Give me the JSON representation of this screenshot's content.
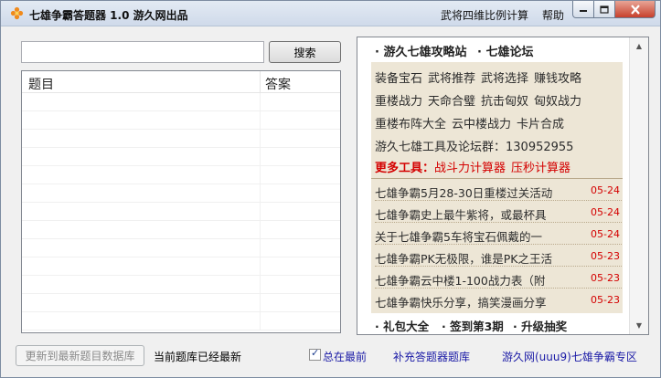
{
  "window": {
    "title": "七雄争霸答题器 1.0   游久网出品",
    "menu": [
      "武将四维比例计算",
      "帮助"
    ],
    "colors": {
      "accent_red": "#d40000",
      "link_blue": "#1a1aa6",
      "panel_bg": "#ede6d6"
    }
  },
  "icons": {
    "app": "orange-flower-icon",
    "minimize": "minimize-icon",
    "maximize": "maximize-icon",
    "close": "close-icon"
  },
  "search": {
    "value": "",
    "placeholder": "",
    "button_label": "搜索"
  },
  "list": {
    "columns": [
      "题目",
      "答案"
    ],
    "rows": []
  },
  "panel": {
    "top_links": [
      "· 游久七雄攻略站",
      "· 七雄论坛"
    ],
    "link_lines": [
      [
        "装备宝石",
        "武将推荐",
        "武将选择",
        "赚钱攻略"
      ],
      [
        "重楼战力",
        "天命合璧",
        "抗击匈奴",
        "匈奴战力"
      ],
      [
        "重楼布阵大全",
        "云中楼战力",
        "卡片合成"
      ]
    ],
    "forum_group": "游久七雄工具及论坛群：130952955",
    "more_tools": {
      "label": "更多工具：",
      "items": [
        "战斗力计算器",
        "压秒计算器"
      ]
    },
    "news": [
      {
        "title": "七雄争霸5月28-30日重楼过关活动",
        "date": "05-24"
      },
      {
        "title": "七雄争霸史上最牛紫将，或最杯具",
        "date": "05-24"
      },
      {
        "title": "关于七雄争霸5车将宝石佩戴的一",
        "date": "05-24"
      },
      {
        "title": "七雄争霸PK无极限，谁是PK之王活",
        "date": "05-23"
      },
      {
        "title": "七雄争霸云中楼1-100战力表（附",
        "date": "05-23"
      },
      {
        "title": "七雄争霸快乐分享，搞笑漫画分享",
        "date": "05-23"
      }
    ],
    "bottom_links": [
      "· 礼包大全",
      "· 签到第3期",
      "· 升级抽奖"
    ]
  },
  "footer": {
    "update_button": "更新到最新题目数据库",
    "status": "当前题库已经最新",
    "always_on_top": {
      "label": "总在最前",
      "checked": true
    },
    "supplement_link": "补充答题器题库",
    "site_link": "游久网(uuu9)七雄争霸专区"
  }
}
